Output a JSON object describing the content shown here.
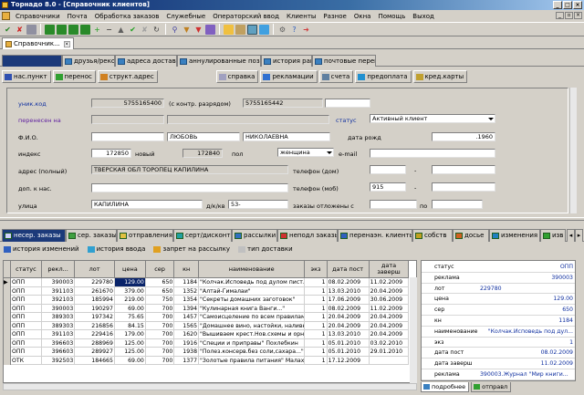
{
  "window": {
    "title": "Торнадо 8.0 - [Справочник клиентов]"
  },
  "menu": [
    "Справочники",
    "Почта",
    "Обработка заказов",
    "Служебные",
    "Операторский ввод",
    "Клиенты",
    "Разное",
    "Окна",
    "Помощь",
    "Выход"
  ],
  "doc_tab": {
    "label": "Справочник..."
  },
  "section_tabs": [
    {
      "label": ""
    },
    {
      "label": "друзья/рекоменд."
    },
    {
      "label": "адреса доставки"
    },
    {
      "label": "аннулированные позиции"
    },
    {
      "label": "история рангов"
    },
    {
      "label": "почтовые переводы"
    }
  ],
  "actions": [
    {
      "label": "нас.пункт"
    },
    {
      "label": "перенос"
    },
    {
      "label": "структ.адрес"
    },
    {
      "label": "справка"
    },
    {
      "label": "рекламации"
    },
    {
      "label": "счета"
    },
    {
      "label": "предоплата"
    },
    {
      "label": "кред.карты"
    }
  ],
  "form": {
    "uniq_label": "уник.код",
    "uniq_value": "5755165400",
    "kontr_label": "(с контр. разрядом)",
    "kontr_value": "5755165442",
    "moved_label": "перенесен на",
    "status_label": "статус",
    "status_value": "Активный клиент",
    "fio_label": "Ф.И.О.",
    "name": "ЛЮБОВЬ",
    "patronymic": "НИКОЛАЕВНА",
    "birth_label": "дата рожд",
    "birth_value": ".1960",
    "index_label": "индекс",
    "index_value": "172850",
    "new_label": "новый",
    "new_index": "172840",
    "sex_label": "пол",
    "sex_value": "женщина",
    "email_label": "e-mail",
    "address_label": "адрес (полный)",
    "address_value": "ТВЕРСКАЯ ОБЛ ТОРОПЕЦ КАПИЛИНА",
    "phone_home_label": "телефон (дом)",
    "extra_label": "доп. к нас.",
    "phone_mob_label": "телефон (моб)",
    "phone_mob_code": "915",
    "street_label": "улица",
    "street_value": "КАПИЛИНА",
    "house_label": "д/к/кв",
    "house_value": "53-",
    "postponed_label": "заказы отложены с",
    "postponed_to": "по",
    "dash": "-"
  },
  "bottom_tabs": [
    {
      "label": "несер. заказы"
    },
    {
      "label": "сер. заказы"
    },
    {
      "label": "отправления"
    },
    {
      "label": "серт/дисконт"
    },
    {
      "label": "рассылки"
    },
    {
      "label": "неподл заказы"
    },
    {
      "label": "перенаэн. клиенты"
    },
    {
      "label": "собств"
    },
    {
      "label": "досье"
    },
    {
      "label": "изменения"
    },
    {
      "label": "изв"
    }
  ],
  "bottom_actions": [
    {
      "label": "история изменений"
    },
    {
      "label": "история ввода"
    },
    {
      "label": "запрет на рассылку"
    },
    {
      "label": "тип доставки"
    }
  ],
  "table": {
    "headers": [
      "статус",
      "рекл...",
      "лот",
      "цена",
      "сер",
      "кн",
      "наименование",
      "экз",
      "дата пост",
      "дата заверш"
    ],
    "rows": [
      [
        "ОПП",
        "390003",
        "229780",
        "129.00",
        "650",
        "1184",
        "\"Колчак.Исповедь под дулом пист.\"",
        "1",
        "08.02.2009",
        "11.02.2009"
      ],
      [
        "ОПП",
        "391103",
        "261670",
        "379.00",
        "650",
        "1352",
        "\"Алтай-Гималаи\"",
        "1",
        "13.03.2010",
        "20.04.2009"
      ],
      [
        "ОПП",
        "392103",
        "185994",
        "219.00",
        "750",
        "1354",
        "\"Секреты домашних заготовок\"",
        "1",
        "17.06.2009",
        "30.06.2009"
      ],
      [
        "ОПП",
        "390003",
        "190297",
        "69.00",
        "700",
        "1394",
        "\"Кулинарная книга Ванги...\"",
        "1",
        "08.02.2009",
        "11.02.2009"
      ],
      [
        "ОПП",
        "389303",
        "197342",
        "75.65",
        "700",
        "1457",
        "\"Самоисцеление по всем правилам\"",
        "1",
        "20.04.2009",
        "20.04.2009"
      ],
      [
        "ОПП",
        "389303",
        "216856",
        "84.15",
        "700",
        "1565",
        "\"Домашнее вино, настойки, наливки\"",
        "1",
        "20.04.2009",
        "20.04.2009"
      ],
      [
        "ОПП",
        "391103",
        "229416",
        "179.00",
        "700",
        "1620",
        "\"Вышиваем крест.Нов.схемы и орнам.\"",
        "1",
        "13.03.2010",
        "20.04.2009"
      ],
      [
        "ОПП",
        "396603",
        "288969",
        "125.00",
        "700",
        "1916",
        "\"Специи и приправы\" Похлебкин",
        "1",
        "05.01.2010",
        "03.02.2010"
      ],
      [
        "ОПП",
        "396603",
        "289927",
        "125.00",
        "700",
        "1938",
        "\"Полез.консерв.без соли,сахара...\"",
        "1",
        "05.01.2010",
        "29.01.2010"
      ],
      [
        "ОТК",
        "392503",
        "184665",
        "69.00",
        "700",
        "1377",
        "\"Золотые правила питания\" Малахов Г",
        "1",
        "17.12.2009",
        ""
      ]
    ]
  },
  "detail": {
    "rows": [
      {
        "k": "статус",
        "v": "ОПП"
      },
      {
        "k": "реклама",
        "v": "390003"
      },
      {
        "k": "лот",
        "v": "229780"
      },
      {
        "k": "цена",
        "v": "129.00"
      },
      {
        "k": "сер",
        "v": "650"
      },
      {
        "k": "кн",
        "v": "1184"
      },
      {
        "k": "наименование",
        "v": "\"Колчак.Исповедь под дул..."
      },
      {
        "k": "экз",
        "v": "1"
      },
      {
        "k": "дата пост",
        "v": "08.02.2009"
      },
      {
        "k": "дата заверш",
        "v": "11.02.2009"
      },
      {
        "k": "реклама",
        "v": "390003.Журнал \"Мир книги..."
      }
    ],
    "tabs": [
      {
        "label": "подробнее"
      },
      {
        "label": "отправл"
      }
    ]
  }
}
